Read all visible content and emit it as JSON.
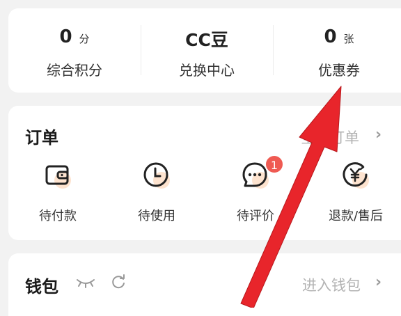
{
  "stats": [
    {
      "value": "0",
      "unit": "分",
      "label": "综合积分"
    },
    {
      "value": "CC豆",
      "unit": "",
      "label": "兑换中心"
    },
    {
      "value": "0",
      "unit": "张",
      "label": "优惠券"
    }
  ],
  "orders": {
    "title": "订单",
    "all_link": "全部订单",
    "items": [
      {
        "label": "待付款",
        "icon": "wallet-icon"
      },
      {
        "label": "待使用",
        "icon": "clock-icon"
      },
      {
        "label": "待评价",
        "icon": "chat-icon",
        "badge": "1"
      },
      {
        "label": "退款/售后",
        "icon": "yen-refund-icon"
      }
    ]
  },
  "wallet": {
    "title": "钱包",
    "enter_link": "进入钱包"
  },
  "colors": {
    "accent_shadow": "#fde3cf",
    "badge": "#ef5a52",
    "arrow": "#e8252b"
  }
}
